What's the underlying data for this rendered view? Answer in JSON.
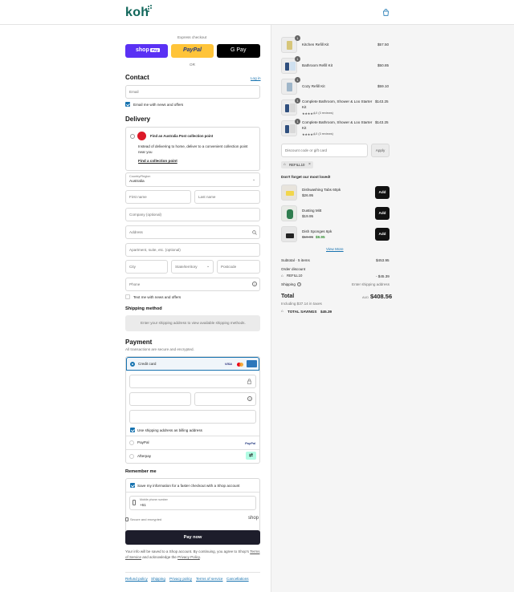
{
  "header": {
    "logo": "koh",
    "cart_icon": "shopping-bag-icon"
  },
  "express": {
    "label": "Express checkout",
    "shop_pay": "shop",
    "shop_pay_badge": "Pay",
    "paypal": "PayPal",
    "gpay": "G Pay",
    "or": "OR"
  },
  "contact": {
    "title": "Contact",
    "login": "Log in",
    "email_placeholder": "Email",
    "news_label": "Email me with news and offers"
  },
  "delivery": {
    "title": "Delivery",
    "auspost_title": "Find an Australia Post collection point",
    "auspost_desc": "Instead of delivering to home, deliver to a convenient collection point near you",
    "auspost_link": "Find a collection point",
    "country_label": "Country/Region",
    "country_value": "Australia",
    "first_name": "First name",
    "last_name": "Last name",
    "company": "Company (optional)",
    "address": "Address",
    "apartment": "Apartment, suite, etc. (optional)",
    "city": "City",
    "state": "State/territory",
    "postcode": "Postcode",
    "phone": "Phone",
    "text_news": "Text me with news and offers"
  },
  "shipping": {
    "title": "Shipping method",
    "info": "Enter your shipping address to view available shipping methods."
  },
  "payment": {
    "title": "Payment",
    "subtitle": "All transactions are secure and encrypted.",
    "credit_card": "Credit card",
    "visa": "VISA",
    "billing_label": "Use shipping address as billing address",
    "paypal": "PayPal",
    "paypal_logo": "PayPal",
    "afterpay": "Afterpay"
  },
  "remember": {
    "title": "Remember me",
    "save_label": "Save my information for a faster checkout with a Shop account",
    "mobile_label": "Mobile phone number",
    "mobile_value": "+61",
    "secure": "Secure and encrypted",
    "shop": "shop"
  },
  "pay_now": "Pay now",
  "terms": {
    "text1": "Your info will be saved to a Shop account. By continuing, you agree to Shop's",
    "tos": "Terms of Service",
    "and": "and acknowledge the",
    "privacy": "Privacy Policy",
    "end": "."
  },
  "footer_links": [
    "Refund policy",
    "Shipping",
    "Privacy policy",
    "Terms of service",
    "Cancellations"
  ],
  "cart": {
    "items": [
      {
        "qty": "1",
        "name": "Kitchen Refill Kit",
        "price": "$57.50"
      },
      {
        "qty": "1",
        "name": "Bathroom Refill Kit",
        "price": "$50.85"
      },
      {
        "qty": "1",
        "name": "Cozy Refill Kit",
        "price": "$59.10"
      },
      {
        "qty": "1",
        "name": "Complete Bathroom, Shower & Loo Starter Kit",
        "price": "$143.25",
        "rating": "4.0 (3 reviews)"
      },
      {
        "qty": "1",
        "name": "Complete Bathroom, Shower & Loo Starter Kit",
        "price": "$143.25",
        "rating": "4.0 (3 reviews)"
      }
    ],
    "stars": "★★★★☆",
    "discount_placeholder": "Discount code or gift card",
    "apply": "Apply",
    "code": "REFILL10",
    "upsell_title": "Don't forget our most loved!",
    "upsell": [
      {
        "name": "Dishwashing Tabs 60pk",
        "price": "$26.95",
        "old": "",
        "add": "Add"
      },
      {
        "name": "Dusting Mitt",
        "price": "$19.95",
        "old": "",
        "add": "Add"
      },
      {
        "name": "Dish Sponges 6pk",
        "price": "$9.95",
        "old": "$19.95",
        "add": "Add"
      }
    ],
    "view_more": "View More",
    "subtotal_label": "Subtotal · 5 items",
    "subtotal": "$453.95",
    "order_discount": "Order discount",
    "discount_code": "REFILL10",
    "discount_amount": "- $45.39",
    "shipping_label": "Shipping",
    "shipping_value": "Enter shipping address",
    "total_label": "Total",
    "currency": "AUD",
    "total": "$408.56",
    "taxes": "Including $37.14 in taxes",
    "savings_label": "TOTAL SAVINGS",
    "savings": "$45.39"
  },
  "colors": {
    "accent": "#1773b0",
    "brand": "#10665a",
    "shop_pay": "#5a31f4",
    "paypal": "#ffc439"
  }
}
